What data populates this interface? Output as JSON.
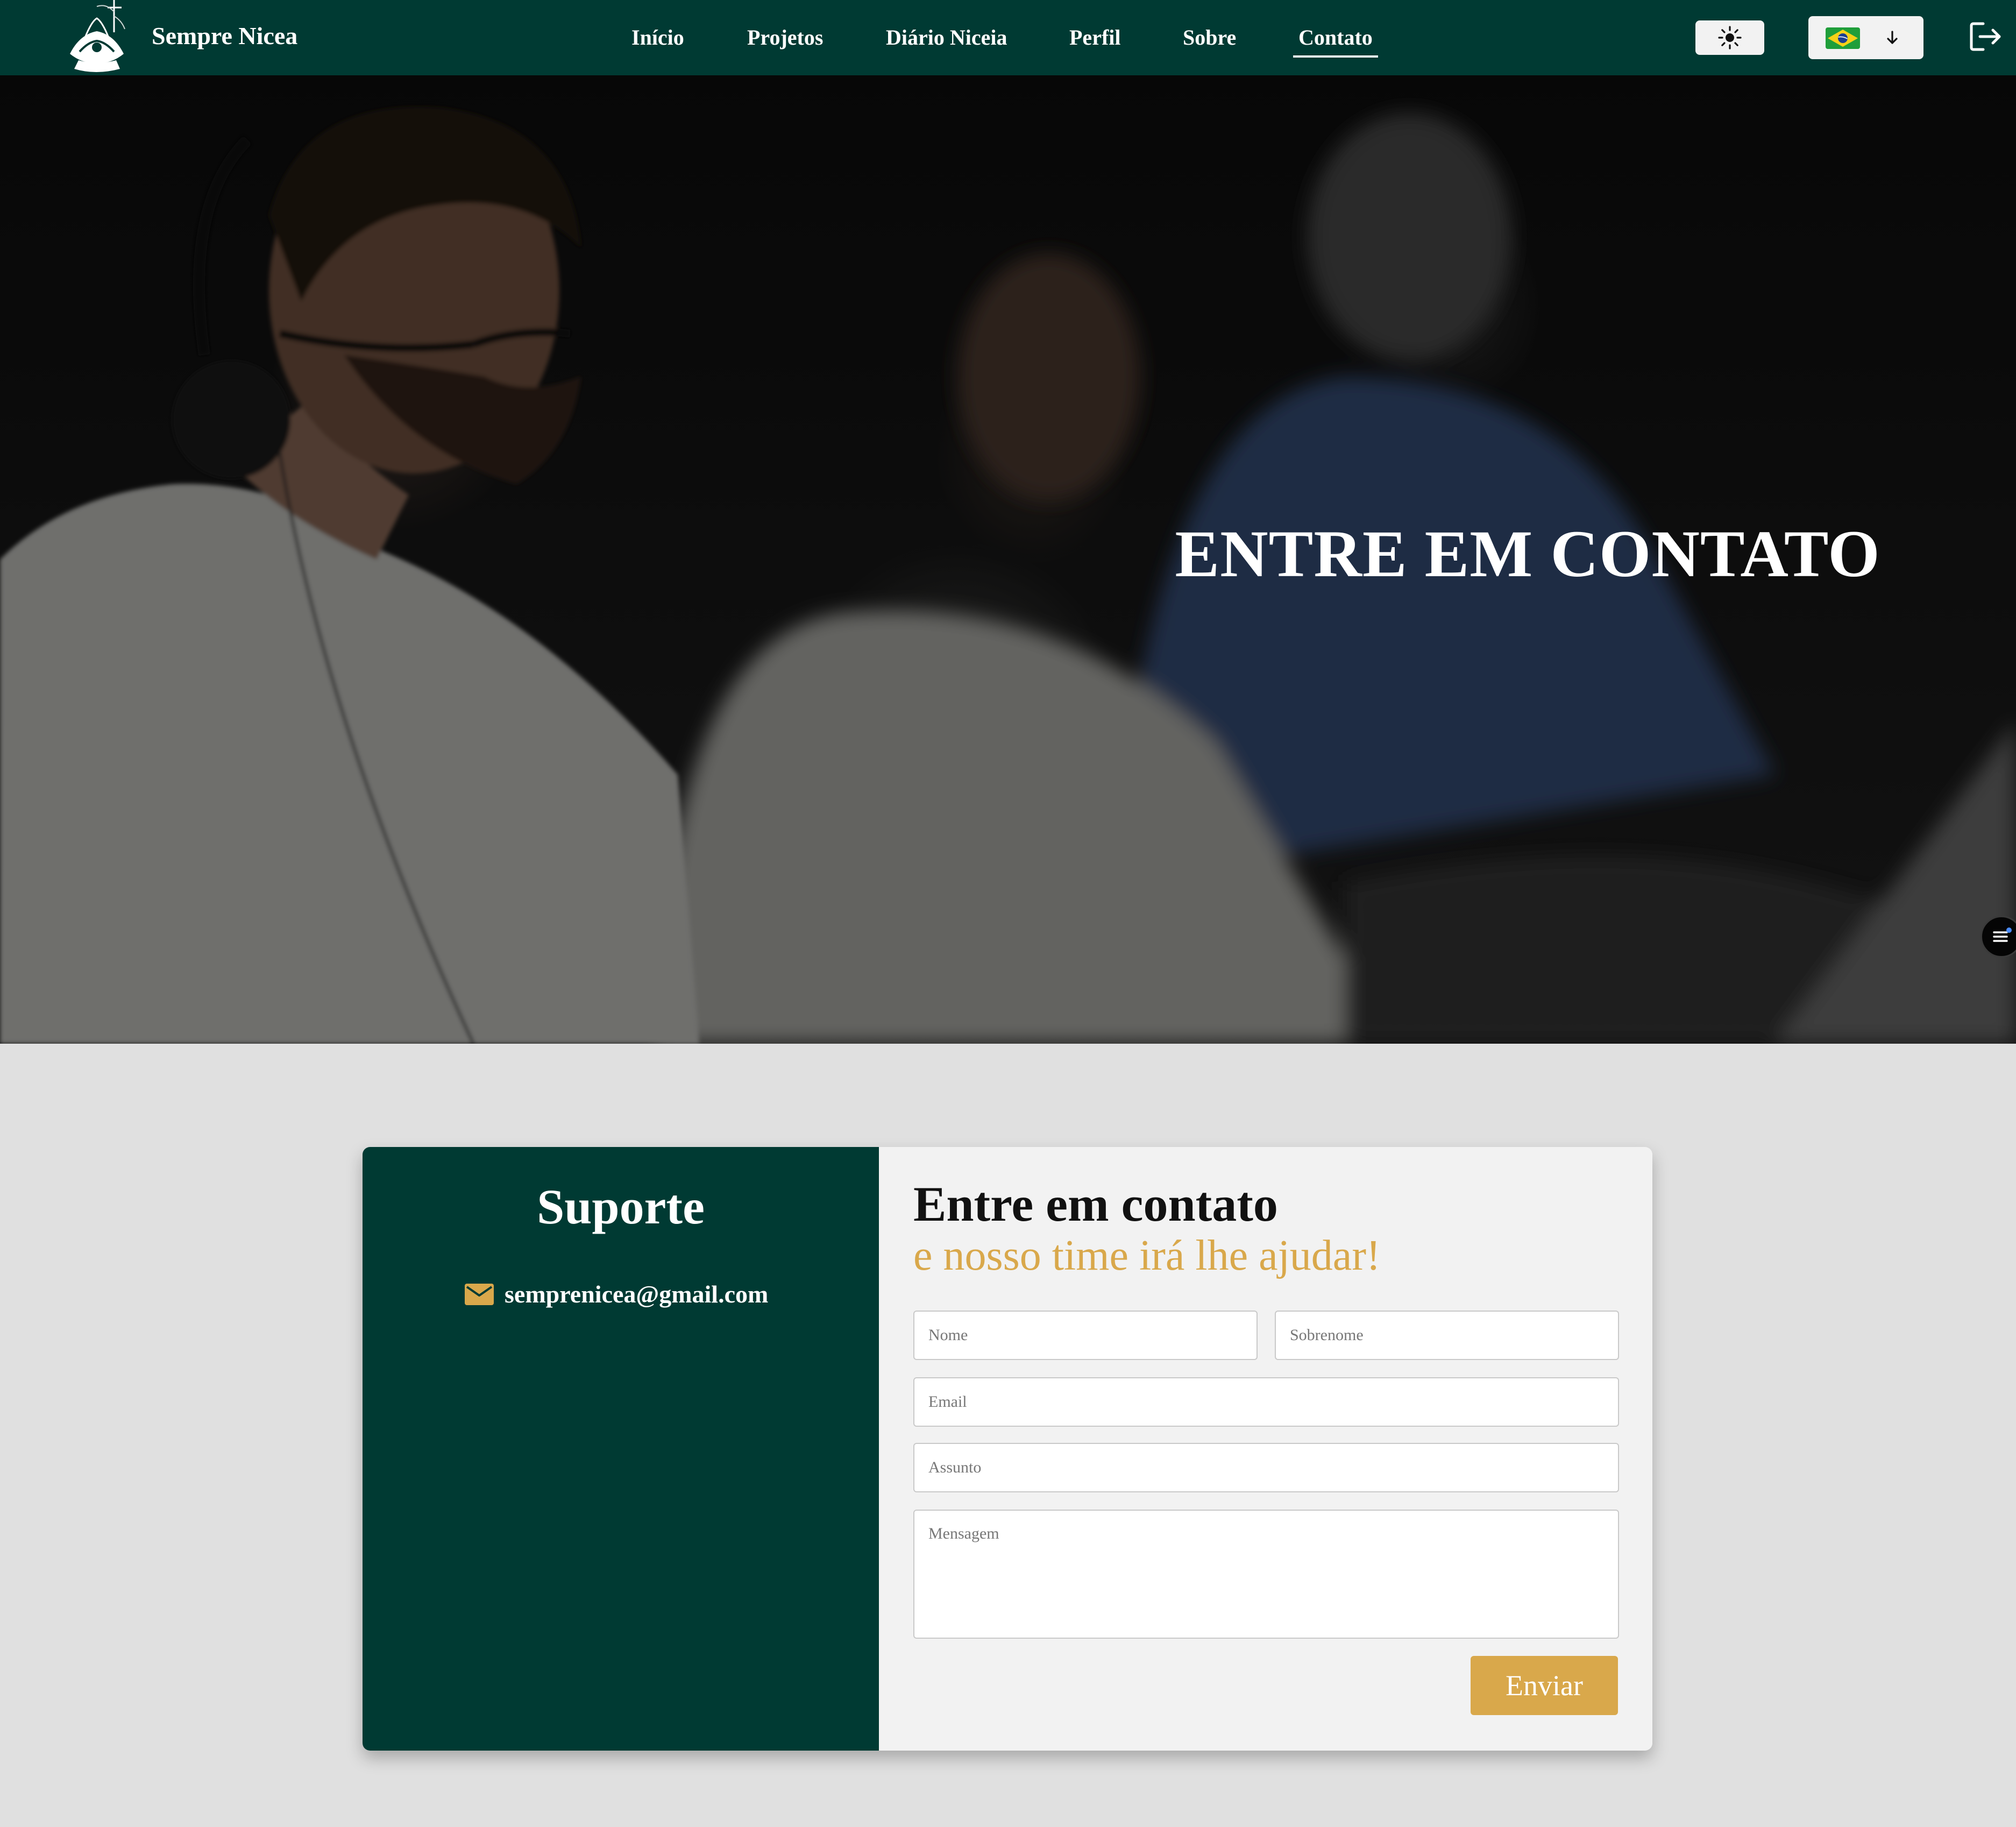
{
  "app": {
    "brand": "Sempre Nicea"
  },
  "nav": {
    "items": [
      {
        "label": "Início",
        "active": false
      },
      {
        "label": "Projetos",
        "active": false
      },
      {
        "label": "Diário Niceia",
        "active": false
      },
      {
        "label": "Perfil",
        "active": false
      },
      {
        "label": "Sobre",
        "active": false
      },
      {
        "label": "Contato",
        "active": true
      }
    ],
    "theme_toggle_icon": "sun-icon",
    "language_icon": "brazil-flag-icon",
    "language_dropdown_icon": "arrow-down-icon",
    "logout_icon": "logout-icon"
  },
  "hero": {
    "title": "ENTRE EM CONTATO"
  },
  "support": {
    "title": "Suporte",
    "email_icon": "mail-icon",
    "email": "semprenicea@gmail.com"
  },
  "form": {
    "title": "Entre em contato",
    "subtitle": "e nosso time irá lhe ajudar!",
    "first_name": {
      "placeholder": "Nome",
      "value": ""
    },
    "last_name": {
      "placeholder": "Sobrenome",
      "value": ""
    },
    "email": {
      "placeholder": "Email",
      "value": ""
    },
    "subject": {
      "placeholder": "Assunto",
      "value": ""
    },
    "message": {
      "placeholder": "Mensagem",
      "value": ""
    },
    "submit_label": "Enviar"
  },
  "colors": {
    "primary_green": "#003a33",
    "accent_gold": "#d9a84b",
    "page_background": "#e0e0e0",
    "card_background": "#f2f2f2"
  }
}
